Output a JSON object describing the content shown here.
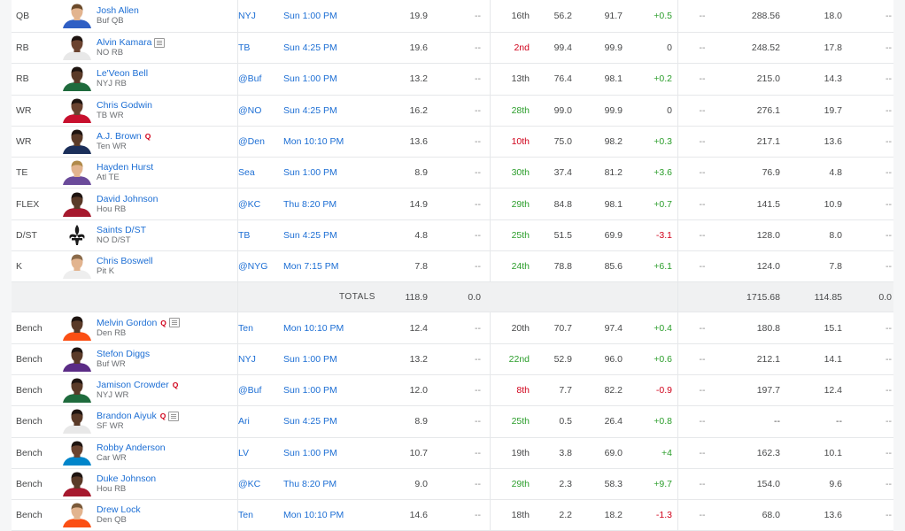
{
  "starters": [
    {
      "slot": "QB",
      "name": "Josh Allen",
      "tag": "Buf QB",
      "inj": "",
      "note": false,
      "opp": "NYJ",
      "time": "Sun 1:00 PM",
      "proj": "19.9",
      "score": "--",
      "oprk": "16th",
      "oprk_color": "plain",
      "start": "56.2",
      "ros": "91.7",
      "chg": "+0.5",
      "chg_color": "green",
      "c1": "--",
      "fpts": "288.56",
      "avg": "18.0",
      "last": "--",
      "jersey": "#2f5fc4",
      "skin": "#e2b48f",
      "hair": "#6b4a2a"
    },
    {
      "slot": "RB",
      "name": "Alvin Kamara",
      "tag": "NO RB",
      "inj": "",
      "note": true,
      "opp": "TB",
      "time": "Sun 4:25 PM",
      "proj": "19.6",
      "score": "--",
      "oprk": "2nd",
      "oprk_color": "red",
      "start": "99.4",
      "ros": "99.9",
      "chg": "0",
      "chg_color": "plain",
      "c1": "--",
      "fpts": "248.52",
      "avg": "17.8",
      "last": "--",
      "jersey": "#e8e8e8",
      "skin": "#6b4330",
      "hair": "#1e1410"
    },
    {
      "slot": "RB",
      "name": "Le'Veon Bell",
      "tag": "NYJ RB",
      "inj": "",
      "note": false,
      "opp": "@Buf",
      "time": "Sun 1:00 PM",
      "proj": "13.2",
      "score": "--",
      "oprk": "13th",
      "oprk_color": "plain",
      "start": "76.4",
      "ros": "98.1",
      "chg": "+0.2",
      "chg_color": "green",
      "c1": "--",
      "fpts": "215.0",
      "avg": "14.3",
      "last": "--",
      "jersey": "#1f6b3d",
      "skin": "#5a3a28",
      "hair": "#1e1410"
    },
    {
      "slot": "WR",
      "name": "Chris Godwin",
      "tag": "TB WR",
      "inj": "",
      "note": false,
      "opp": "@NO",
      "time": "Sun 4:25 PM",
      "proj": "16.2",
      "score": "--",
      "oprk": "28th",
      "oprk_color": "green",
      "start": "99.0",
      "ros": "99.9",
      "chg": "0",
      "chg_color": "plain",
      "c1": "--",
      "fpts": "276.1",
      "avg": "19.7",
      "last": "--",
      "jersey": "#c8102e",
      "skin": "#6a4330",
      "hair": "#1e1410"
    },
    {
      "slot": "WR",
      "name": "A.J. Brown",
      "tag": "Ten WR",
      "inj": "Q",
      "note": false,
      "opp": "@Den",
      "time": "Mon 10:10 PM",
      "proj": "13.6",
      "score": "--",
      "oprk": "10th",
      "oprk_color": "red",
      "start": "75.0",
      "ros": "98.2",
      "chg": "+0.3",
      "chg_color": "green",
      "c1": "--",
      "fpts": "217.1",
      "avg": "13.6",
      "last": "--",
      "jersey": "#1b2f5a",
      "skin": "#5a3a28",
      "hair": "#1e1410"
    },
    {
      "slot": "TE",
      "name": "Hayden Hurst",
      "tag": "Atl TE",
      "inj": "",
      "note": false,
      "opp": "Sea",
      "time": "Sun 1:00 PM",
      "proj": "8.9",
      "score": "--",
      "oprk": "30th",
      "oprk_color": "green",
      "start": "37.4",
      "ros": "81.2",
      "chg": "+3.6",
      "chg_color": "green",
      "c1": "--",
      "fpts": "76.9",
      "avg": "4.8",
      "last": "--",
      "jersey": "#6a4a9a",
      "skin": "#e2b48f",
      "hair": "#b08a4a"
    },
    {
      "slot": "FLEX",
      "name": "David Johnson",
      "tag": "Hou RB",
      "inj": "",
      "note": false,
      "opp": "@KC",
      "time": "Thu 8:20 PM",
      "proj": "14.9",
      "score": "--",
      "oprk": "29th",
      "oprk_color": "green",
      "start": "84.8",
      "ros": "98.1",
      "chg": "+0.7",
      "chg_color": "green",
      "c1": "--",
      "fpts": "141.5",
      "avg": "10.9",
      "last": "--",
      "jersey": "#a6192e",
      "skin": "#5a3a28",
      "hair": "#1e1410"
    },
    {
      "slot": "D/ST",
      "name": "Saints D/ST",
      "tag": "NO D/ST",
      "inj": "",
      "note": false,
      "opp": "TB",
      "time": "Sun 4:25 PM",
      "proj": "4.8",
      "score": "--",
      "oprk": "25th",
      "oprk_color": "green",
      "start": "51.5",
      "ros": "69.9",
      "chg": "-3.1",
      "chg_color": "red",
      "c1": "--",
      "fpts": "128.0",
      "avg": "8.0",
      "last": "--",
      "jersey": "logo",
      "skin": "",
      "hair": ""
    },
    {
      "slot": "K",
      "name": "Chris Boswell",
      "tag": "Pit K",
      "inj": "",
      "note": false,
      "opp": "@NYG",
      "time": "Mon 7:15 PM",
      "proj": "7.8",
      "score": "--",
      "oprk": "24th",
      "oprk_color": "green",
      "start": "78.8",
      "ros": "85.6",
      "chg": "+6.1",
      "chg_color": "green",
      "c1": "--",
      "fpts": "124.0",
      "avg": "7.8",
      "last": "--",
      "jersey": "#eeeeee",
      "skin": "#e2b48f",
      "hair": "#8a6a4a"
    }
  ],
  "totals": {
    "label": "TOTALS",
    "proj": "118.9",
    "score": "0.0",
    "fpts": "1715.68",
    "avg": "114.85",
    "last": "0.0"
  },
  "bench": [
    {
      "slot": "Bench",
      "name": "Melvin Gordon",
      "tag": "Den RB",
      "inj": "Q",
      "note": true,
      "opp": "Ten",
      "time": "Mon 10:10 PM",
      "proj": "12.4",
      "score": "--",
      "oprk": "20th",
      "oprk_color": "plain",
      "start": "70.7",
      "ros": "97.4",
      "chg": "+0.4",
      "chg_color": "green",
      "c1": "--",
      "fpts": "180.8",
      "avg": "15.1",
      "last": "--",
      "jersey": "#fb4f14",
      "skin": "#5a3a28",
      "hair": "#1e1410"
    },
    {
      "slot": "Bench",
      "name": "Stefon Diggs",
      "tag": "Buf WR",
      "inj": "",
      "note": false,
      "opp": "NYJ",
      "time": "Sun 1:00 PM",
      "proj": "13.2",
      "score": "--",
      "oprk": "22nd",
      "oprk_color": "green",
      "start": "52.9",
      "ros": "96.0",
      "chg": "+0.6",
      "chg_color": "green",
      "c1": "--",
      "fpts": "212.1",
      "avg": "14.1",
      "last": "--",
      "jersey": "#5b2c86",
      "skin": "#5a3a28",
      "hair": "#1e1410"
    },
    {
      "slot": "Bench",
      "name": "Jamison Crowder",
      "tag": "NYJ WR",
      "inj": "Q",
      "note": false,
      "opp": "@Buf",
      "time": "Sun 1:00 PM",
      "proj": "12.0",
      "score": "--",
      "oprk": "8th",
      "oprk_color": "red",
      "start": "7.7",
      "ros": "82.2",
      "chg": "-0.9",
      "chg_color": "red",
      "c1": "--",
      "fpts": "197.7",
      "avg": "12.4",
      "last": "--",
      "jersey": "#1f6b3d",
      "skin": "#5a3a28",
      "hair": "#1e1410"
    },
    {
      "slot": "Bench",
      "name": "Brandon Aiyuk",
      "tag": "SF WR",
      "inj": "Q",
      "note": true,
      "opp": "Ari",
      "time": "Sun 4:25 PM",
      "proj": "8.9",
      "score": "--",
      "oprk": "25th",
      "oprk_color": "green",
      "start": "0.5",
      "ros": "26.4",
      "chg": "+0.8",
      "chg_color": "green",
      "c1": "--",
      "fpts": "--",
      "avg": "--",
      "last": "--",
      "jersey": "#e8e8e8",
      "skin": "#5a3a28",
      "hair": "#1e1410"
    },
    {
      "slot": "Bench",
      "name": "Robby Anderson",
      "tag": "Car WR",
      "inj": "",
      "note": false,
      "opp": "LV",
      "time": "Sun 1:00 PM",
      "proj": "10.7",
      "score": "--",
      "oprk": "19th",
      "oprk_color": "plain",
      "start": "3.8",
      "ros": "69.0",
      "chg": "+4",
      "chg_color": "green",
      "c1": "--",
      "fpts": "162.3",
      "avg": "10.1",
      "last": "--",
      "jersey": "#0085ca",
      "skin": "#6a4330",
      "hair": "#1e1410"
    },
    {
      "slot": "Bench",
      "name": "Duke Johnson",
      "tag": "Hou RB",
      "inj": "",
      "note": false,
      "opp": "@KC",
      "time": "Thu 8:20 PM",
      "proj": "9.0",
      "score": "--",
      "oprk": "29th",
      "oprk_color": "green",
      "start": "2.3",
      "ros": "58.3",
      "chg": "+9.7",
      "chg_color": "green",
      "c1": "--",
      "fpts": "154.0",
      "avg": "9.6",
      "last": "--",
      "jersey": "#a6192e",
      "skin": "#5a3a28",
      "hair": "#1e1410"
    },
    {
      "slot": "Bench",
      "name": "Drew Lock",
      "tag": "Den QB",
      "inj": "",
      "note": false,
      "opp": "Ten",
      "time": "Mon 10:10 PM",
      "proj": "14.6",
      "score": "--",
      "oprk": "18th",
      "oprk_color": "plain",
      "start": "2.2",
      "ros": "18.2",
      "chg": "-1.3",
      "chg_color": "red",
      "c1": "--",
      "fpts": "68.0",
      "avg": "13.6",
      "last": "--",
      "jersey": "#fb4f14",
      "skin": "#e2b48f",
      "hair": "#7a5a3a"
    }
  ]
}
